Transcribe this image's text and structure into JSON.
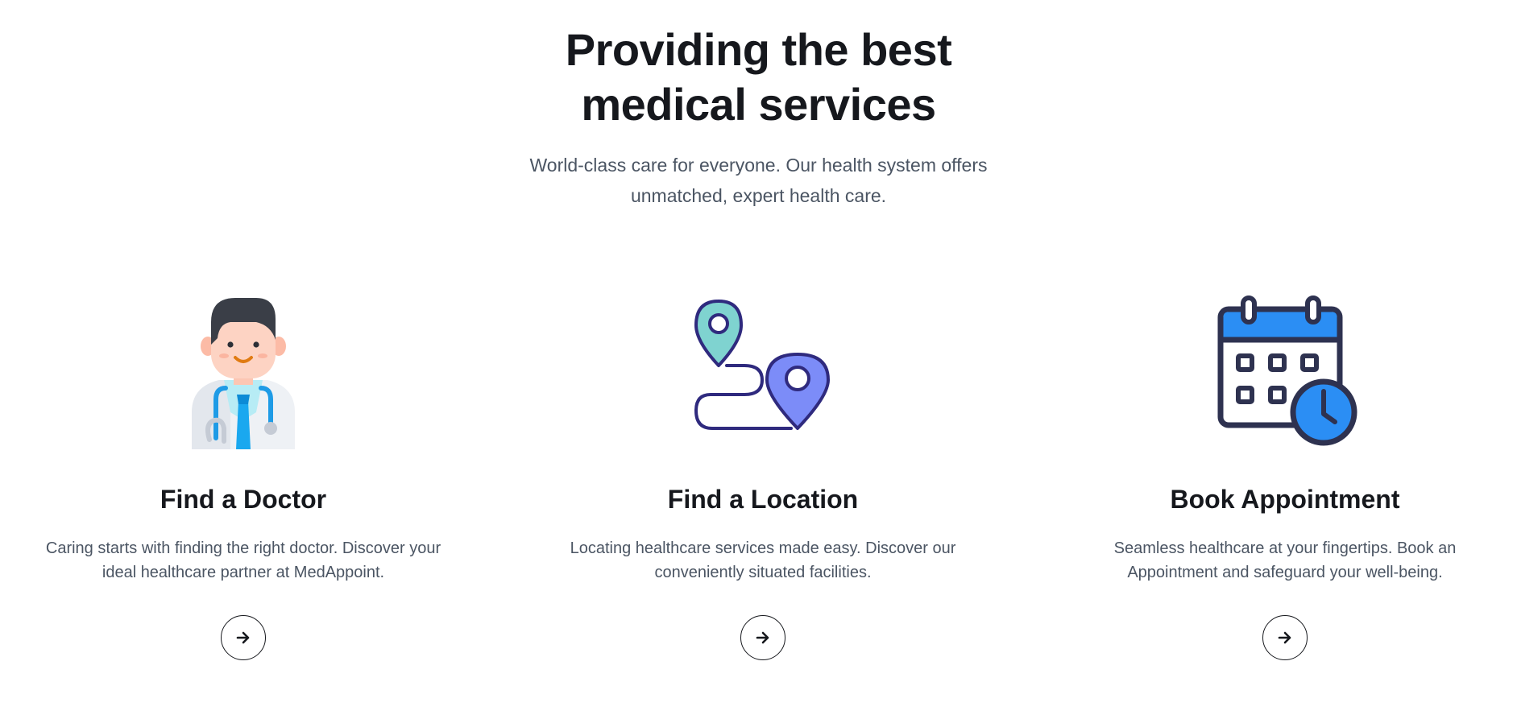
{
  "hero": {
    "title_line1": "Providing the best",
    "title_line2": "medical services",
    "subtitle_line1": "World-class care for everyone. Our health system offers",
    "subtitle_line2": "unmatched, expert health care."
  },
  "cards": [
    {
      "icon": "doctor-icon",
      "title": "Find a Doctor",
      "desc_line1": "Caring starts with finding the right doctor. Discover your",
      "desc_line2": "ideal healthcare partner at MedAppoint.",
      "button_icon": "arrow-right-icon"
    },
    {
      "icon": "location-route-icon",
      "title": "Find a Location",
      "desc_line1": "Locating healthcare services made easy. Discover our",
      "desc_line2": "conveniently situated facilities.",
      "button_icon": "arrow-right-icon"
    },
    {
      "icon": "calendar-clock-icon",
      "title": "Book Appointment",
      "desc_line1": "Seamless healthcare at your fingertips. Book an",
      "desc_line2": "Appointment and safeguard your well-being.",
      "button_icon": "arrow-right-icon"
    }
  ],
  "colors": {
    "heading": "#16181d",
    "body_text": "#4b5563",
    "calendar_blue": "#2b8ef4",
    "calendar_navy": "#2e3250",
    "pin_teal": "#7fd3d0",
    "pin_purple": "#7c8cf8",
    "route_navy": "#2f2a7e"
  }
}
